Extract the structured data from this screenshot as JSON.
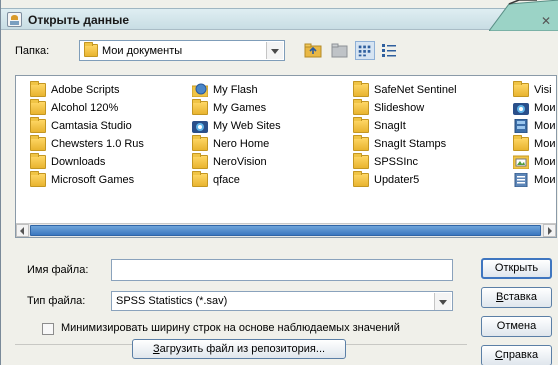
{
  "window": {
    "title": "Открыть данные"
  },
  "folder": {
    "label": "Папка:",
    "value": "Мои документы"
  },
  "files": [
    {
      "name": "Adobe Scripts",
      "icon": "folder-icon"
    },
    {
      "name": "Alcohol 120%",
      "icon": "folder-icon"
    },
    {
      "name": "Camtasia Studio",
      "icon": "folder-icon"
    },
    {
      "name": "Chewsters 1.0 Rus",
      "icon": "folder-icon"
    },
    {
      "name": "Downloads",
      "icon": "folder-icon"
    },
    {
      "name": "Microsoft Games",
      "icon": "folder-icon"
    },
    {
      "name": "My Flash",
      "icon": "flash-folder-icon"
    },
    {
      "name": "My Games",
      "icon": "folder-icon"
    },
    {
      "name": "My Web Sites",
      "icon": "web-sites-icon"
    },
    {
      "name": "Nero Home",
      "icon": "folder-icon"
    },
    {
      "name": "NeroVision",
      "icon": "folder-icon"
    },
    {
      "name": "qface",
      "icon": "folder-icon"
    },
    {
      "name": "SafeNet Sentinel",
      "icon": "folder-icon"
    },
    {
      "name": "Slideshow",
      "icon": "folder-icon"
    },
    {
      "name": "SnagIt",
      "icon": "folder-icon"
    },
    {
      "name": "SnagIt Stamps",
      "icon": "folder-icon"
    },
    {
      "name": "SPSSInc",
      "icon": "folder-icon"
    },
    {
      "name": "Updater5",
      "icon": "folder-icon"
    },
    {
      "name": "Visi",
      "icon": "folder-icon"
    },
    {
      "name": "Мои",
      "icon": "web-sites-icon"
    },
    {
      "name": "Мои",
      "icon": "video-folder-icon"
    },
    {
      "name": "Мои",
      "icon": "folder-icon"
    },
    {
      "name": "Мои",
      "icon": "pictures-folder-icon"
    },
    {
      "name": "Мои",
      "icon": "documents-folder-icon"
    }
  ],
  "form": {
    "filename_label": "Имя файла:",
    "filename_value": "",
    "filetype_label": "Тип файла:",
    "filetype_value": "SPSS Statistics (*.sav)",
    "minimize_label": "Минимизировать ширину строк на основе наблюдаемых значений",
    "repo_button": "Загрузить файл из репозитория..."
  },
  "buttons": {
    "open": "Открыть",
    "paste": "Вставка",
    "cancel": "Отмена",
    "help": "Справка"
  },
  "colors": {
    "accent": "#3c78c0",
    "folder": "#f0c445"
  }
}
